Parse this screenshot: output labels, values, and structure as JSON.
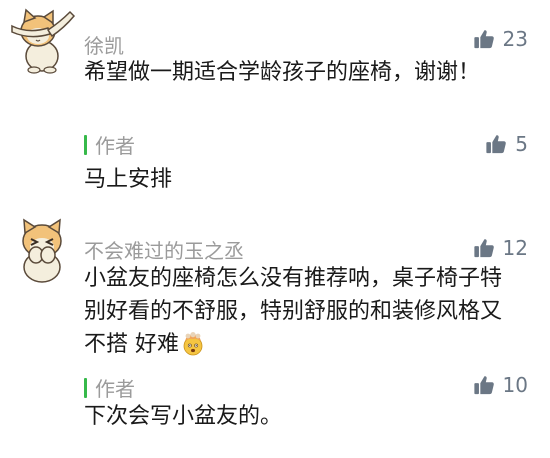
{
  "comments": [
    {
      "user": {
        "name": "徐凯",
        "avatar_icon": "dabbing-cat-avatar"
      },
      "likes": "23",
      "text": "希望做一期适合学龄孩子的座椅，谢谢！",
      "reply": {
        "author_label": "作者",
        "likes": "5",
        "text": "马上安排"
      }
    },
    {
      "user": {
        "name": "不会难过的玉之丞",
        "avatar_icon": "crying-cat-avatar"
      },
      "likes": "12",
      "text": "小盆友的座椅怎么没有推荐呐，桌子椅子特别好看的不舒服，特别舒服的和装修风格又不搭 好难",
      "text_emoji": "exploding-head-emoji",
      "reply": {
        "author_label": "作者",
        "likes": "10",
        "text": "下次会写小盆友的。"
      }
    }
  ],
  "colors": {
    "author_bar": "#36b94a",
    "like_icon": "#6b7785",
    "username": "#9b9b9b",
    "text": "#1a1a1a"
  }
}
